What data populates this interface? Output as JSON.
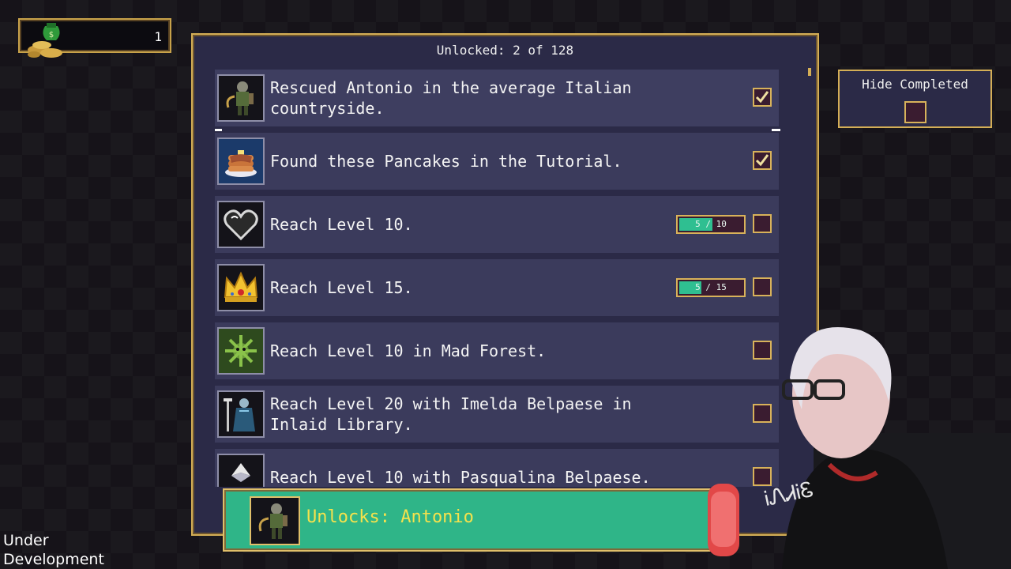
{
  "gold": {
    "value": "1",
    "icon": "money-bag-icon"
  },
  "header": {
    "unlocked_text": "Unlocked: 2 of 128"
  },
  "colors": {
    "panel": "#2b2a47",
    "row": "#3b3b5c",
    "gold_border": "#d4ae56",
    "progress_fill": "#2fbf91",
    "unlock_bar": "#2fb588",
    "unlock_text": "#f5e24c"
  },
  "achievements": [
    {
      "text": "Rescued Antonio in the average Italian countryside.",
      "icon": "antonio-icon",
      "checked": true,
      "selected": true
    },
    {
      "text": "Found these Pancakes in the Tutorial.",
      "icon": "pancakes-icon",
      "checked": true
    },
    {
      "text": "Reach Level 10.",
      "icon": "heart-icon",
      "checked": false,
      "progress": {
        "label": "5 / 10",
        "current": 5,
        "max": 10
      }
    },
    {
      "text": "Reach Level 15.",
      "icon": "crown-icon",
      "checked": false,
      "progress": {
        "label": "5 / 15",
        "current": 5,
        "max": 15
      }
    },
    {
      "text": "Reach Level 10 in Mad Forest.",
      "icon": "mad-forest-icon",
      "checked": false
    },
    {
      "text": "Reach Level 20 with Imelda Belpaese in Inlaid Library.",
      "icon": "imelda-icon",
      "checked": false
    },
    {
      "text": "Reach Level 10 with Pasqualina Belpaese.",
      "icon": "pasqualina-icon",
      "checked": false
    }
  ],
  "unlock_bar": {
    "text": "Unlocks: Antonio",
    "icon": "antonio-icon"
  },
  "hide_completed": {
    "label": "Hide Completed",
    "checked": false
  },
  "overlay": {
    "dev_line1": "Under",
    "dev_line2": "Development"
  }
}
